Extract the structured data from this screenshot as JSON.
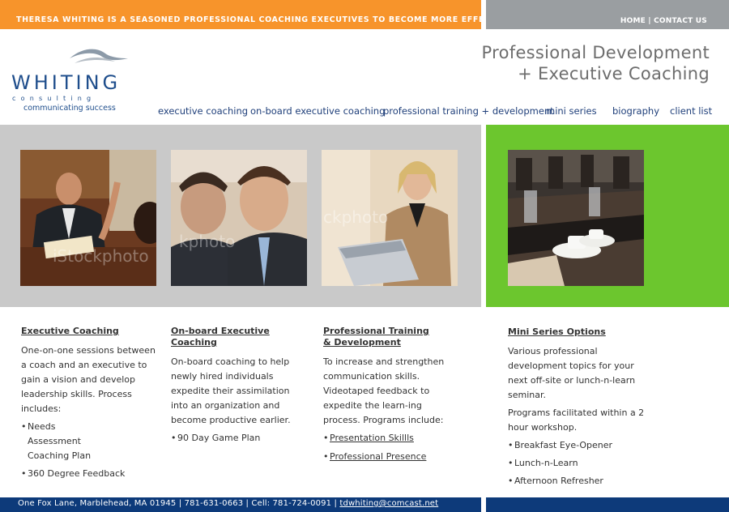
{
  "topbar": {
    "tagline": "THERESA WHITING IS A SEASONED PROFESSIONAL COACHING EXECUTIVES TO BECOME MORE EFFECTIVE LEADERS.",
    "nav_home": "HOME",
    "nav_sep": " | ",
    "nav_contact": "CONTACT US"
  },
  "logo": {
    "word": "WHITING",
    "sub": "consulting",
    "tagline": "communicating success"
  },
  "headline": {
    "line1": "Professional Development",
    "line2": "+ Executive Coaching"
  },
  "mainnav": {
    "items": [
      "executive coaching",
      "on-board executive coaching",
      "professional training + development",
      "mini series",
      "biography",
      "client list"
    ]
  },
  "photos": {
    "watermark": "iStockphoto",
    "watermark2": "ckphoto"
  },
  "columns": [
    {
      "title": "Executive Coaching",
      "body": "One-on-one sessions between a coach and an executive to gain a vision and develop leadership skills. Process includes:",
      "bullets": [
        "Needs Assessment Coaching Plan",
        "360 Degree Feedback"
      ]
    },
    {
      "title": "On-board Executive Coaching",
      "body": "On-board coaching to help newly hired individuals expedite their assimilation into an organization and become productive earlier.",
      "bullets": [
        "90 Day Game Plan"
      ]
    },
    {
      "title_line1": "Professional Training",
      "title_line2": "& Development",
      "body": "To increase and strengthen communication skills. Videotaped feedback to expedite the learn-ing process. Programs include:",
      "links": [
        "Presentation Skillls",
        "Professional Presence"
      ]
    },
    {
      "title": "Mini Series Options",
      "body": "Various professional development topics for your next off-site or lunch-n-learn seminar.",
      "body2": "Programs facilitated within a 2 hour workshop.",
      "bullets": [
        "Breakfast Eye-Opener",
        "Lunch-n-Learn",
        "Afternoon Refresher"
      ]
    }
  ],
  "footer": {
    "address": "One Fox Lane, Marblehead, MA 01945 | 781-631-0663 | Cell: 781-724-0091  | ",
    "email": "tdwhiting@comcast.net"
  },
  "colors": {
    "orange": "#f7942b",
    "gray": "#9a9ea1",
    "navy": "#0d3a7a",
    "green": "#6cc62e",
    "light_gray_band": "#c9c9c9"
  }
}
